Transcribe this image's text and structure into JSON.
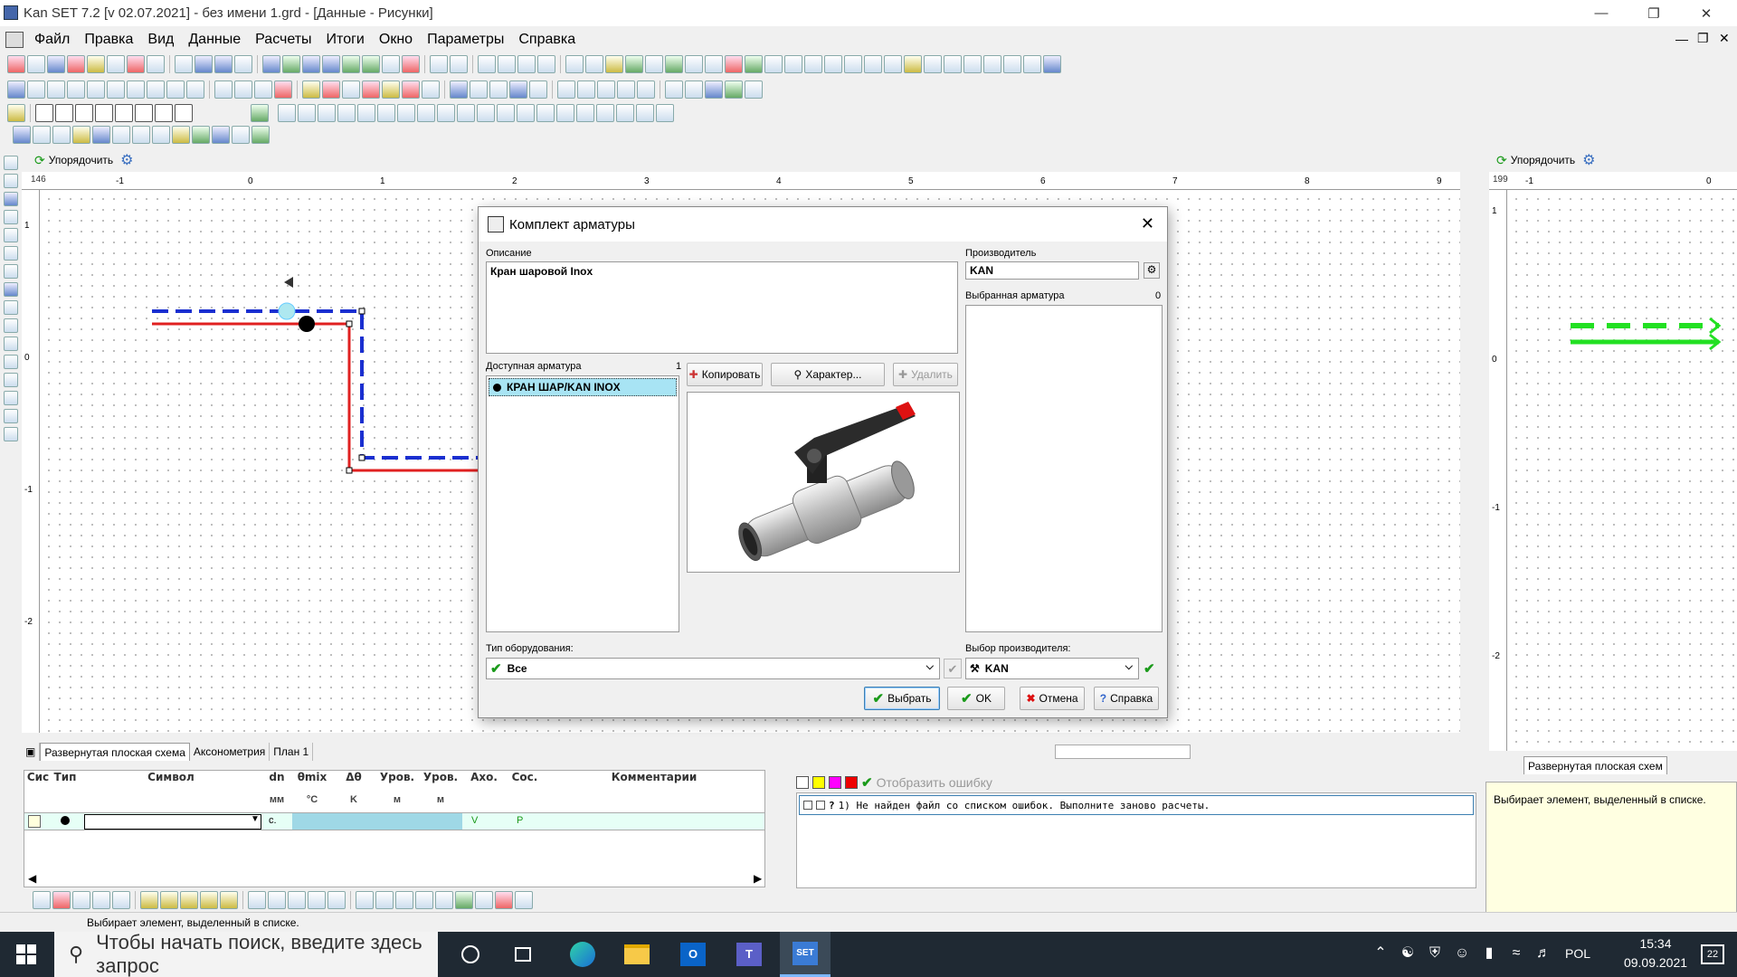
{
  "window": {
    "title": "Kan SET 7.2   [v 02.07.2021] - без имени 1.grd - [Данные - Рисунки]"
  },
  "menu": [
    "Файл",
    "Правка",
    "Вид",
    "Данные",
    "Расчеты",
    "Итоги",
    "Окно",
    "Параметры",
    "Справка"
  ],
  "drawing": {
    "arrange_label": "Упорядочить",
    "ruler_top_start": "146",
    "h_ticks": [
      "-1",
      "0",
      "1",
      "2",
      "3",
      "4",
      "5",
      "6",
      "7",
      "8",
      "9"
    ],
    "v_ticks": [
      "1",
      "0",
      "-1",
      "-2"
    ]
  },
  "right_pane": {
    "arrange_label": "Упорядочить",
    "ruler_top_start": "199",
    "h_ticks": [
      "-1",
      "0"
    ],
    "v_ticks": [
      "1",
      "0",
      "-1",
      "-2"
    ],
    "tab_label": "Развернутая плоская схем"
  },
  "dialog": {
    "title": "Комплект арматуры",
    "description_label": "Описание",
    "description_value": "Кран шаровой Inox",
    "available_label": "Доступная арматура",
    "available_count": "1",
    "available_items": [
      "КРАН ШАР/KAN INOX"
    ],
    "copy_button": "Копировать",
    "properties_button": "Характер...",
    "delete_button": "Удалить",
    "manufacturer_label": "Производитель",
    "manufacturer_value": "KAN",
    "selected_label": "Выбранная арматура",
    "selected_count": "0",
    "equipment_type_label": "Тип оборудования:",
    "equipment_type_value": "Все",
    "manufacturer_select_label": "Выбор производителя:",
    "manufacturer_select_value": "KAN",
    "select_button": "Выбрать",
    "ok_button": "OK",
    "cancel_button": "Отмена",
    "help_button": "Справка"
  },
  "bottom_tabs": [
    "Развернутая плоская схема",
    "Аксонометрия",
    "План 1"
  ],
  "table": {
    "headers": [
      "Сис",
      "Тип",
      "Символ",
      "dn",
      "θmix",
      "Δθ",
      "Уров.",
      "Уров.",
      "Ахо.",
      "Сос.",
      "Комментарии"
    ],
    "units": [
      "мм",
      "°C",
      "K",
      "м",
      "м"
    ],
    "row_cells": [
      "с.",
      "V",
      "P"
    ]
  },
  "errors": {
    "show_error_button": "Отобразить ошибку",
    "items": [
      "1) Не найден файл со списком ошибок. Выполните заново расчеты."
    ]
  },
  "hint": {
    "text": "Выбирает элемент, выделенный в списке."
  },
  "status": {
    "text": "Выбирает элемент, выделенный в списке."
  },
  "taskbar": {
    "search_placeholder": "Чтобы начать поиск, введите здесь запрос",
    "language": "POL",
    "time": "15:34",
    "date": "09.09.2021",
    "notifications": "22"
  },
  "colors": {
    "accent": "#3c7fb1",
    "pipe_red": "#e02020",
    "pipe_blue": "#1a2fd0",
    "pipe_green": "#22e022",
    "selection": "#66ccff",
    "hint_bg": "#ffffe1",
    "taskbar": "#1f2933"
  }
}
